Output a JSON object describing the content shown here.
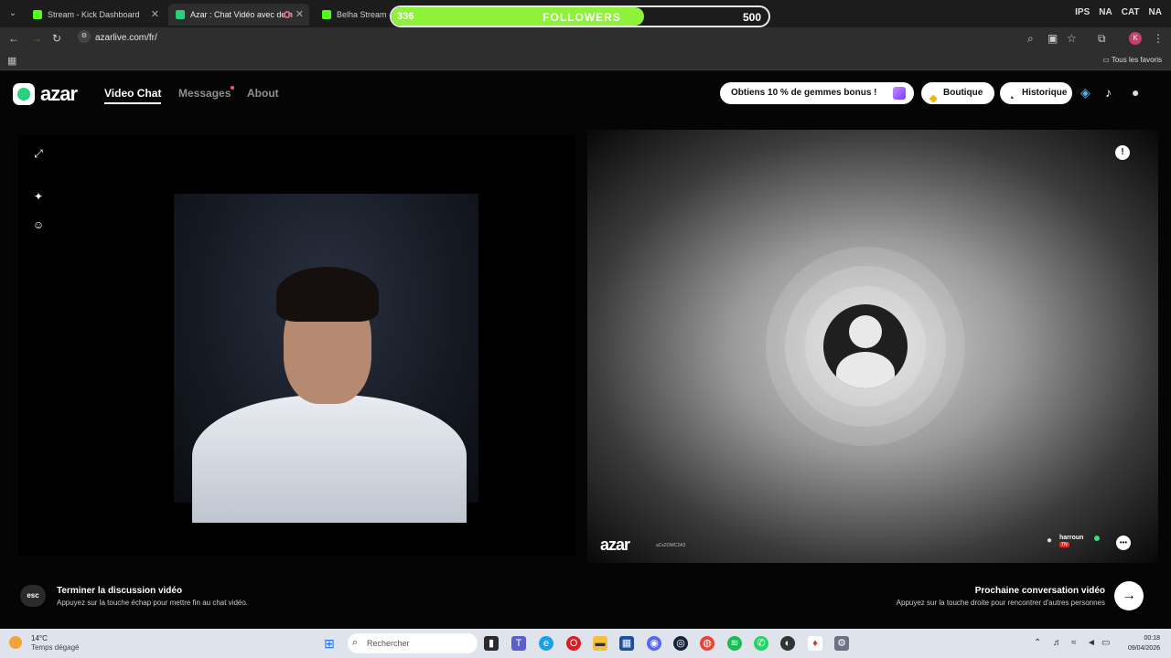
{
  "browser": {
    "tabs": [
      {
        "title": "Stream - Kick Dashboard",
        "favicon_color": "#53fc18"
      },
      {
        "title": "Azar : Chat Vidéo avec de n",
        "favicon_color": "#27d27b"
      },
      {
        "title": "Belha Stream - W",
        "favicon_color": "#53fc18"
      }
    ],
    "tabbar_right": [
      "IPS",
      "NA",
      "CAT",
      "NA"
    ],
    "url": "azarlive.com/fr/",
    "bookmarks_right": "Tous les favoris",
    "profile_initial": "K"
  },
  "followers": {
    "current": "336",
    "label": "FOLLOWERS",
    "goal": "500",
    "progress": 0.67,
    "fill_color": "#8ef13a"
  },
  "app": {
    "logo": "azar",
    "nav": {
      "video_chat": "Video Chat",
      "messages": "Messages",
      "about": "About"
    },
    "promo": "Obtiens 10 % de gemmes bonus !",
    "boutique": "Boutique",
    "historique": "Historique",
    "watermark": "azar",
    "watermark_id": "aCs2OMC2A3",
    "peer": {
      "name": "harroun",
      "flag": "TN"
    },
    "end": {
      "key": "esc",
      "title": "Terminer la discussion vidéo",
      "subtitle": "Appuyez sur la touche échap pour mettre fin au chat vidéo."
    },
    "next": {
      "title": "Prochaine conversation vidéo",
      "subtitle": "Appuyez sur la touche droite pour rencontrer d'autres personnes"
    }
  },
  "taskbar": {
    "temperature": "14°C",
    "weather": "Temps dégagé",
    "search_placeholder": "Rechercher",
    "time": "00:18",
    "date": "09/04/2026"
  }
}
